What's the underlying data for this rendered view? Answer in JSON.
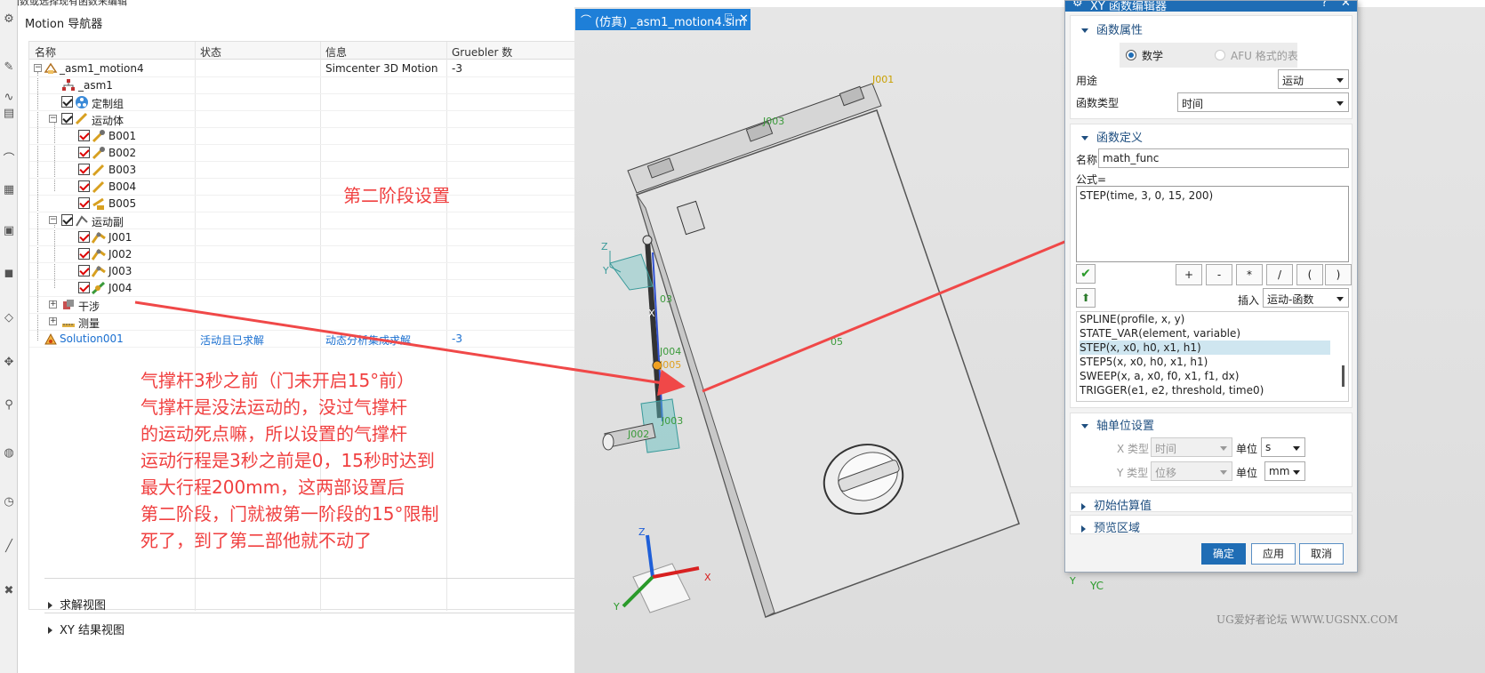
{
  "top_strip_text": "建函数或选择现有函数来编辑",
  "navigator": {
    "title": "Motion 导航器",
    "columns": [
      "名称",
      "状态",
      "信息",
      "Gruebler 数"
    ],
    "rows": [
      {
        "name": "_asm1_motion4",
        "status": "",
        "info": "Simcenter 3D Motion",
        "gruebler": "-3"
      },
      {
        "name": "_asm1"
      },
      {
        "name": "定制组"
      },
      {
        "name": "运动体"
      },
      {
        "name": "B001"
      },
      {
        "name": "B002"
      },
      {
        "name": "B003"
      },
      {
        "name": "B004"
      },
      {
        "name": "B005"
      },
      {
        "name": "运动副"
      },
      {
        "name": "J001"
      },
      {
        "name": "J002"
      },
      {
        "name": "J003"
      },
      {
        "name": "J004"
      },
      {
        "name": "干涉"
      },
      {
        "name": "测量"
      },
      {
        "name": "Solution001",
        "status": "活动且已求解",
        "info": "动态分析集成求解",
        "gruebler": "-3"
      }
    ],
    "bottom_sections": [
      "求解视图",
      "XY 结果视图"
    ]
  },
  "annotations": {
    "stage2": "第二阶段设置",
    "lines": [
      "气撑杆3秒之前（门未开启15°前）",
      "气撑杆是没法运动的，没过气撑杆",
      "的运动死点嘛，所以设置的气撑杆",
      "运动行程是3秒之前是0，15秒时达到",
      "最大行程200mm，这两部设置后",
      "第二阶段，门就被第一阶段的15°限制",
      "死了，到了第二部他就不动了"
    ]
  },
  "graphics": {
    "tab_label": "(仿真) _asm1_motion4.sim",
    "labels": {
      "j001": "J001",
      "j003": "J003",
      "j004": "J004",
      "j005": "J005",
      "j002": "J002",
      "j003b": "J003",
      "code05": "05",
      "code03": "03"
    },
    "triad_model": {
      "z": "Z",
      "x": "X",
      "y": "Y"
    },
    "triad_view": {
      "z": "Z",
      "x": "X",
      "y": "Y"
    },
    "wcs": {
      "y": "Y",
      "yc": "YC"
    },
    "watermark": "UG爱好者论坛 WWW.UGSNX.COM"
  },
  "dialog": {
    "title": "XY 函数编辑器",
    "sections": {
      "props": "函数属性",
      "def": "函数定义",
      "axis": "轴单位设置",
      "init": "初始估算值",
      "preview": "预览区域"
    },
    "radio_math": "数学",
    "radio_afu": "AFU 格式的表",
    "usage_label": "用途",
    "usage_value": "运动",
    "type_label": "函数类型",
    "type_value": "时间",
    "name_label": "名称",
    "name_value": "math_func",
    "formula_label": "公式=",
    "formula_value": "STEP(time, 3, 0, 15, 200)",
    "ops": [
      "+",
      "-",
      "*",
      "/",
      "(",
      ")"
    ],
    "insert_label": "插入",
    "insert_value": "运动-函数",
    "functions": [
      "SPLINE(profile, x, y)",
      "STATE_VAR(element, variable)",
      "STEP(x, x0, h0, x1, h1)",
      "STEP5(x, x0, h0, x1, h1)",
      "SWEEP(x, a, x0, f0, x1, f1, dx)",
      "TRIGGER(e1, e2, threshold, time0)"
    ],
    "xtype_label": "X 类型",
    "xtype_value": "时间",
    "xunit_label": "单位",
    "xunit_value": "s",
    "ytype_label": "Y 类型",
    "ytype_value": "位移",
    "yunit_label": "单位",
    "yunit_value": "mm",
    "ok": "确定",
    "apply": "应用",
    "cancel": "取消"
  }
}
